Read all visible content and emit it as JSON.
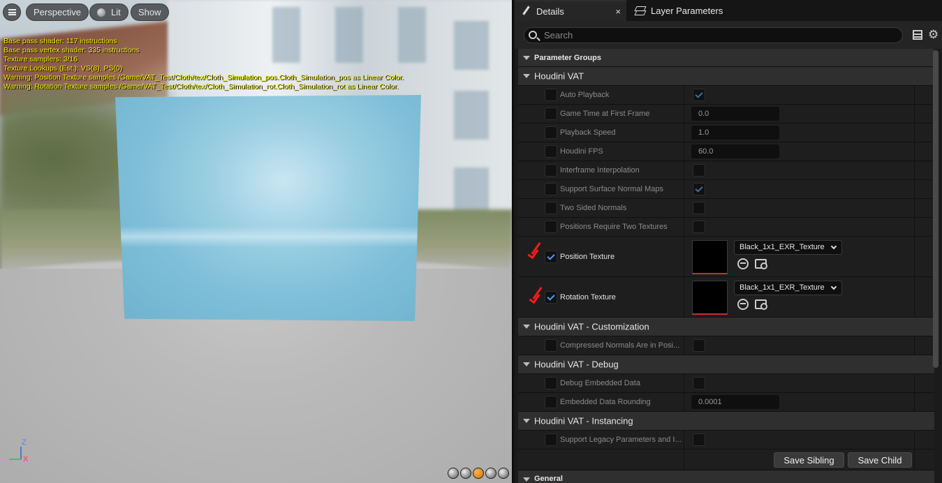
{
  "viewport": {
    "perspective_label": "Perspective",
    "lit_label": "Lit",
    "show_label": "Show",
    "stats": [
      "Base pass shader: 117 instructions",
      "Base pass vertex shader: 335 instructions",
      "Texture samplers: 3/16",
      "Texture Lookups (Est.): VS(8), PS(0)",
      "Warning: Position Texture samples /Game/VAT_Test/Cloth/tex/Cloth_Simulation_pos.Cloth_Simulation_pos as Linear Color.",
      "Warning: Rotation Texture samples /Game/VAT_Test/Cloth/tex/Cloth_Simulation_rot.Cloth_Simulation_rot as Linear Color."
    ],
    "axis": {
      "z": "Z",
      "x": "X"
    }
  },
  "tabs": {
    "details": "Details",
    "close": "×",
    "layer_parameters": "Layer Parameters"
  },
  "search": {
    "placeholder": "Search"
  },
  "groups": {
    "parameter_groups": "Parameter Groups",
    "houdini_vat": "Houdini VAT",
    "customization": "Houdini VAT - Customization",
    "debug": "Houdini VAT - Debug",
    "instancing": "Houdini VAT - Instancing",
    "general": "General"
  },
  "params": {
    "auto_playback": {
      "name": "Auto Playback"
    },
    "game_time": {
      "name": "Game Time at First Frame",
      "value": "0.0"
    },
    "playback_speed": {
      "name": "Playback Speed",
      "value": "1.0"
    },
    "houdini_fps": {
      "name": "Houdini FPS",
      "value": "60.0"
    },
    "interframe": {
      "name": "Interframe Interpolation"
    },
    "surface_normal": {
      "name": "Support Surface Normal Maps"
    },
    "two_sided": {
      "name": "Two Sided Normals"
    },
    "two_textures": {
      "name": "Positions Require Two Textures"
    },
    "position_texture": {
      "name": "Position Texture",
      "asset": "Black_1x1_EXR_Texture"
    },
    "rotation_texture": {
      "name": "Rotation Texture",
      "asset": "Black_1x1_EXR_Texture"
    },
    "compressed_normals": {
      "name": "Compressed Normals Are in Posi..."
    },
    "debug_embedded": {
      "name": "Debug Embedded Data"
    },
    "embedded_rounding": {
      "name": "Embedded Data Rounding",
      "value": "0.0001"
    },
    "legacy_params": {
      "name": "Support Legacy Parameters and I..."
    }
  },
  "buttons": {
    "save_sibling": "Save Sibling",
    "save_child": "Save Child"
  },
  "colors": {
    "accent_check": "#4a9ff5",
    "annotation_red": "#ff1a1a",
    "stats_text": "#f5f000"
  }
}
